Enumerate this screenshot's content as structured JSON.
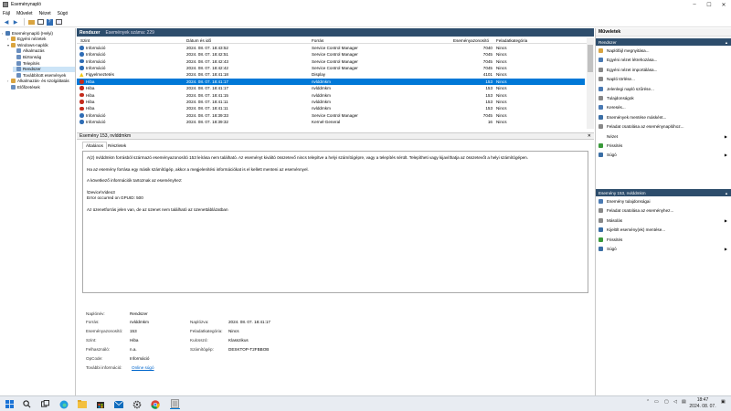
{
  "window": {
    "title": "Eseménynapló"
  },
  "menu": [
    "Fájl",
    "Művelet",
    "Nézet",
    "Súgó"
  ],
  "tree": [
    {
      "label": "Eseménynapló (Helyi)",
      "level": 0,
      "color": "#4a7ab3"
    },
    {
      "label": "Egyéni nézetek",
      "level": 1,
      "color": "#d9a440"
    },
    {
      "label": "Windows-naplók",
      "level": 1,
      "color": "#d9a440"
    },
    {
      "label": "Alkalmazás",
      "level": 2,
      "color": "#6a8fbf"
    },
    {
      "label": "Biztonság",
      "level": 2,
      "color": "#6a8fbf"
    },
    {
      "label": "Telepítés",
      "level": 2,
      "color": "#6a8fbf"
    },
    {
      "label": "Rendszer",
      "level": 2,
      "color": "#6a8fbf",
      "selected": true
    },
    {
      "label": "Továbbított események",
      "level": 2,
      "color": "#6a8fbf"
    },
    {
      "label": "Alkalmazás- és szolgáltatás",
      "level": 1,
      "color": "#d9a440"
    },
    {
      "label": "Előfizetések",
      "level": 1,
      "color": "#6a8fbf"
    }
  ],
  "header": {
    "title": "Rendszer",
    "count": "Események száma: 229"
  },
  "columns": [
    "Szint",
    "Dátum és idő",
    "Forrás",
    "Eseményazonosító",
    "Feladatkategória"
  ],
  "rows": [
    {
      "level": "Információ",
      "type": "info",
      "date": "2024. 08. 07. 18:43:52",
      "source": "Service Control Manager",
      "id": "7040",
      "cat": "Nincs"
    },
    {
      "level": "Információ",
      "type": "info",
      "date": "2024. 08. 07. 18:42:51",
      "source": "Service Control Manager",
      "id": "7045",
      "cat": "Nincs"
    },
    {
      "level": "Információ",
      "type": "info",
      "date": "2024. 08. 07. 18:42:43",
      "source": "Service Control Manager",
      "id": "7045",
      "cat": "Nincs"
    },
    {
      "level": "Információ",
      "type": "info",
      "date": "2024. 08. 07. 18:42:42",
      "source": "Service Control Manager",
      "id": "7045",
      "cat": "Nincs"
    },
    {
      "level": "Figyelmeztetés",
      "type": "warn",
      "date": "2024. 08. 07. 18:41:18",
      "source": "Display",
      "id": "4101",
      "cat": "Nincs"
    },
    {
      "level": "Hiba",
      "type": "error",
      "date": "2024. 08. 07. 18:41:17",
      "source": "nvlddmkm",
      "id": "153",
      "cat": "Nincs",
      "selected": true
    },
    {
      "level": "Hiba",
      "type": "error",
      "date": "2024. 08. 07. 18:41:17",
      "source": "nvlddmkm",
      "id": "153",
      "cat": "Nincs"
    },
    {
      "level": "Hiba",
      "type": "error",
      "date": "2024. 08. 07. 18:41:15",
      "source": "nvlddmkm",
      "id": "153",
      "cat": "Nincs"
    },
    {
      "level": "Hiba",
      "type": "error",
      "date": "2024. 08. 07. 18:41:11",
      "source": "nvlddmkm",
      "id": "153",
      "cat": "Nincs"
    },
    {
      "level": "Hiba",
      "type": "error",
      "date": "2024. 08. 07. 18:41:11",
      "source": "nvlddmkm",
      "id": "153",
      "cat": "Nincs"
    },
    {
      "level": "Információ",
      "type": "info",
      "date": "2024. 08. 07. 18:39:33",
      "source": "Service Control Manager",
      "id": "7045",
      "cat": "Nincs"
    },
    {
      "level": "Információ",
      "type": "info",
      "date": "2024. 08. 07. 18:39:32",
      "source": "Kernel-General",
      "id": "16",
      "cat": "Nincs"
    }
  ],
  "detail": {
    "title": "Esemény 153, nvlddmkm",
    "tabs": [
      "Általános",
      "Részletek"
    ],
    "paragraphs": [
      "A(z) nvlddmkm forrásból származó eseményazonosító 153 leírása nem található. Az eseményt kiváltó összetevő nincs telepítve a helyi számítógépre, vagy a telepítés sérült. Telepítheti vagy kijavíthatja az összetevőt a helyi számítógépen.",
      "Ha az esemény forrása egy másik számítógép, akkor a megjelenítési információkat is el kellett menteni az eseménnyel.",
      "A következő információk tartoznak az eseményhez:",
      "\\Device\\Video3",
      "Error occurred on GPUID: 500",
      "Az üzenetforrás jelen van, de az üzenet nem található az üzenettáblázatban"
    ],
    "fields": {
      "naplonev_label": "Naplónév:",
      "naplonev": "Rendszer",
      "forras_label": "Forrás:",
      "forras": "nvlddmkm",
      "naplozva_label": "Naplózva:",
      "naplozva": "2024. 08. 07. 18:41:17",
      "azon_label": "Eseményazonosító:",
      "azon": "153",
      "feladat_label": "Feladatkategória:",
      "feladat": "Nincs",
      "szint_label": "Szint:",
      "szint": "Hiba",
      "kulcsszo_label": "Kulcsszó:",
      "kulcsszo": "Klasszikus",
      "felh_label": "Felhasználó:",
      "felh": "n.a.",
      "gep_label": "Számítógép:",
      "gep": "DESKTOP-T2FBBOB",
      "opcode_label": "OpCode:",
      "opcode": "Információ",
      "tovabbi_label": "További információ:",
      "tovabbi": "Online súgó"
    }
  },
  "actions": {
    "title": "Műveletek",
    "sec1": "Rendszer",
    "items1": [
      {
        "label": "Naplófájl megnyitása...",
        "color": "#d9a440"
      },
      {
        "label": "Egyéni nézet létrehozása...",
        "color": "#4a7ab3"
      },
      {
        "label": "Egyéni nézet importálása...",
        "color": "#888"
      },
      {
        "label": "Napló törlése...",
        "color": "#888"
      },
      {
        "label": "Jelenlegi napló szűrése...",
        "color": "#4a7ab3"
      },
      {
        "label": "Tulajdonságok",
        "color": "#888"
      },
      {
        "label": "Keresés...",
        "color": "#4a7ab3"
      },
      {
        "label": "Események mentése másként...",
        "color": "#3a6ea5"
      },
      {
        "label": "Feladat csatolása az eseménynaplóhoz...",
        "color": "#888"
      },
      {
        "label": "Nézet",
        "color": "#fff",
        "sub": true
      },
      {
        "label": "Frissítés",
        "color": "#3a9a3a"
      },
      {
        "label": "Súgó",
        "color": "#3a6ea5",
        "sub": true
      }
    ],
    "sec2": "Esemény 153, nvlddmkm",
    "items2": [
      {
        "label": "Esemény tulajdonságai",
        "color": "#4a7ab3"
      },
      {
        "label": "Feladat csatolása az eseményhez...",
        "color": "#888"
      },
      {
        "label": "Másolás",
        "color": "#888",
        "sub": true
      },
      {
        "label": "Kijelölt esemény(ek) mentése...",
        "color": "#3a6ea5"
      },
      {
        "label": "Frissítés",
        "color": "#3a9a3a"
      },
      {
        "label": "Súgó",
        "color": "#3a6ea5",
        "sub": true
      }
    ]
  },
  "taskbar": {
    "time": "18:47",
    "date": "2024. 08. 07."
  },
  "colors": {
    "header_bg": "#2d4d6c",
    "selection": "#0078d7",
    "error": "#c42b1c",
    "info": "#2f6db5",
    "warn": "#f2c811"
  }
}
